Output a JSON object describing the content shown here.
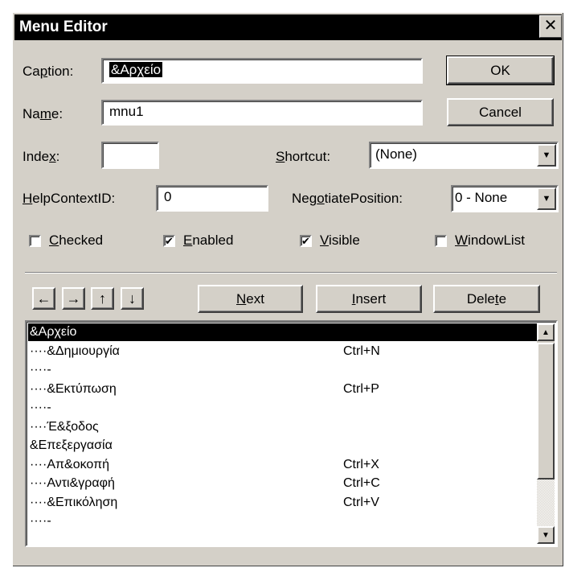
{
  "window": {
    "title": "Menu Editor",
    "close_glyph": "✕"
  },
  "fields": {
    "caption_label_pre": "Ca",
    "caption_label_u": "p",
    "caption_label_post": "tion:",
    "caption_value": "&Αρχείο",
    "name_label_pre": "Na",
    "name_label_u": "m",
    "name_label_post": "e:",
    "name_value": "mnu1",
    "index_label_pre": "Inde",
    "index_label_u": "x",
    "index_label_post": ":",
    "index_value": "",
    "shortcut_label_u": "S",
    "shortcut_label_post": "hortcut:",
    "shortcut_value": "(None)",
    "help_label_u": "H",
    "help_label_post": "elpContextID:",
    "help_value": "0",
    "negotiate_label_pre": "Neg",
    "negotiate_label_u": "o",
    "negotiate_label_post": "tiatePosition:",
    "negotiate_value": "0 - None"
  },
  "checkboxes": [
    {
      "u": "C",
      "rest": "hecked",
      "checked": false
    },
    {
      "u": "E",
      "rest": "nabled",
      "checked": true
    },
    {
      "u": "V",
      "rest": "isible",
      "checked": true
    },
    {
      "u": "W",
      "rest": "indowList",
      "checked": false
    }
  ],
  "buttons": {
    "ok": "OK",
    "cancel": "Cancel",
    "next_u": "N",
    "next_rest": "ext",
    "insert_u": "I",
    "insert_rest": "nsert",
    "delete_pre": "Dele",
    "delete_u": "t",
    "delete_post": "e"
  },
  "arrow_buttons": [
    "←",
    "→",
    "↑",
    "↓"
  ],
  "menu_items": [
    {
      "caption": "&Αρχείο",
      "shortcut": ""
    },
    {
      "caption": "····&Δημιουργία",
      "shortcut": "Ctrl+N"
    },
    {
      "caption": "····-",
      "shortcut": ""
    },
    {
      "caption": "····&Εκτύπωση",
      "shortcut": "Ctrl+P"
    },
    {
      "caption": "····-",
      "shortcut": ""
    },
    {
      "caption": "····Έ&ξοδος",
      "shortcut": ""
    },
    {
      "caption": "&Επεξεργασία",
      "shortcut": ""
    },
    {
      "caption": "····Απ&οκοπή",
      "shortcut": "Ctrl+X"
    },
    {
      "caption": "····Αντι&γραφή",
      "shortcut": "Ctrl+C"
    },
    {
      "caption": "····&Επικόληση",
      "shortcut": "Ctrl+V"
    },
    {
      "caption": "····-",
      "shortcut": ""
    }
  ],
  "selected_index": 0,
  "colors": {
    "face": "#d4d0c8",
    "titlebar": "#000000",
    "selection": "#000000"
  }
}
